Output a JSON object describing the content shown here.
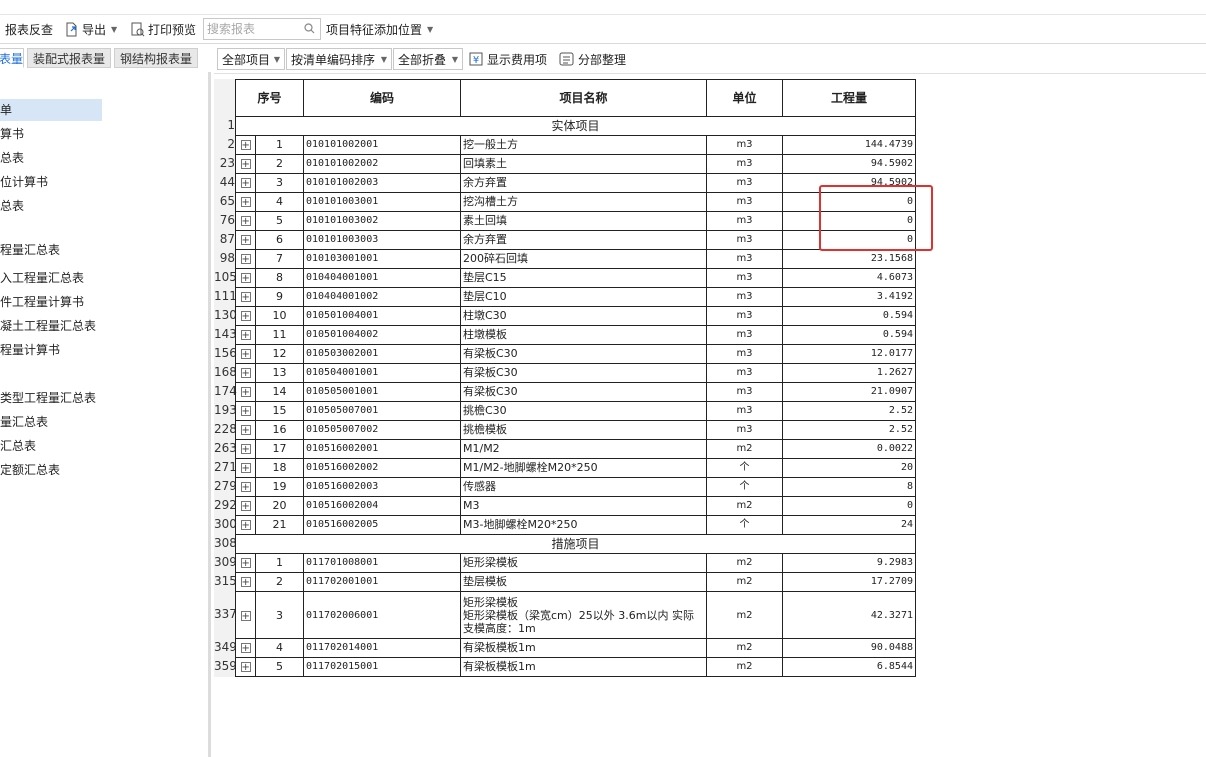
{
  "toolbar": {
    "check_label": "报表反查",
    "export_label": "导出",
    "print_label": "打印预览",
    "search_placeholder": "搜索报表",
    "feature_pos_label": "项目特征添加位置"
  },
  "tabs": [
    {
      "label": "表量",
      "active": true
    },
    {
      "label": "装配式报表量",
      "active": false
    },
    {
      "label": "钢结构报表量",
      "active": false
    }
  ],
  "sidebar": {
    "items": [
      {
        "label": "单",
        "selected": true
      },
      {
        "label": "算书"
      },
      {
        "label": "总表"
      },
      {
        "label": "位计算书"
      },
      {
        "label": "总表"
      },
      {
        "label": ""
      },
      {
        "label": "程量汇总表"
      },
      {
        "label": "入工程量汇总表"
      },
      {
        "label": "件工程量计算书"
      },
      {
        "label": "凝土工程量汇总表"
      },
      {
        "label": "程量计算书"
      },
      {
        "label": ""
      },
      {
        "label": "类型工程量汇总表"
      },
      {
        "label": "量汇总表"
      },
      {
        "label": "汇总表"
      },
      {
        "label": "定额汇总表"
      }
    ]
  },
  "toolbar2": {
    "all_items": "全部项目",
    "sort_by": "按清单编码排序",
    "fold_all": "全部折叠",
    "show_fee": "显示费用项",
    "arrange": "分部整理"
  },
  "table": {
    "headers": {
      "no": "序号",
      "code": "编码",
      "name": "项目名称",
      "unit": "单位",
      "qty": "工程量"
    },
    "rows": [
      {
        "type": "section",
        "rownum": "1",
        "title": "实体项目"
      },
      {
        "rownum": "2",
        "no": "1",
        "code": "010101002001",
        "name": "挖一般土方",
        "unit": "m3",
        "qty": "144.4739"
      },
      {
        "rownum": "23",
        "no": "2",
        "code": "010101002002",
        "name": "回填素土",
        "unit": "m3",
        "qty": "94.5902"
      },
      {
        "rownum": "44",
        "no": "3",
        "code": "010101002003",
        "name": "余方弃置",
        "unit": "m3",
        "qty": "94.5902"
      },
      {
        "rownum": "65",
        "no": "4",
        "code": "010101003001",
        "name": "挖沟槽土方",
        "unit": "m3",
        "qty": "0"
      },
      {
        "rownum": "76",
        "no": "5",
        "code": "010101003002",
        "name": "素土回填",
        "unit": "m3",
        "qty": "0"
      },
      {
        "rownum": "87",
        "no": "6",
        "code": "010101003003",
        "name": "余方弃置",
        "unit": "m3",
        "qty": "0"
      },
      {
        "rownum": "98",
        "no": "7",
        "code": "010103001001",
        "name": "200碎石回填",
        "unit": "m3",
        "qty": "23.1568"
      },
      {
        "rownum": "105",
        "no": "8",
        "code": "010404001001",
        "name": "垫层C15",
        "unit": "m3",
        "qty": "4.6073"
      },
      {
        "rownum": "111",
        "no": "9",
        "code": "010404001002",
        "name": "垫层C10",
        "unit": "m3",
        "qty": "3.4192"
      },
      {
        "rownum": "130",
        "no": "10",
        "code": "010501004001",
        "name": "柱墩C30",
        "unit": "m3",
        "qty": "0.594"
      },
      {
        "rownum": "143",
        "no": "11",
        "code": "010501004002",
        "name": "柱墩模板",
        "unit": "m3",
        "qty": "0.594"
      },
      {
        "rownum": "156",
        "no": "12",
        "code": "010503002001",
        "name": "有梁板C30",
        "unit": "m3",
        "qty": "12.0177"
      },
      {
        "rownum": "168",
        "no": "13",
        "code": "010504001001",
        "name": "有梁板C30",
        "unit": "m3",
        "qty": "1.2627"
      },
      {
        "rownum": "174",
        "no": "14",
        "code": "010505001001",
        "name": "有梁板C30",
        "unit": "m3",
        "qty": "21.0907"
      },
      {
        "rownum": "193",
        "no": "15",
        "code": "010505007001",
        "name": "挑檐C30",
        "unit": "m3",
        "qty": "2.52"
      },
      {
        "rownum": "228",
        "no": "16",
        "code": "010505007002",
        "name": "挑檐模板",
        "unit": "m3",
        "qty": "2.52"
      },
      {
        "rownum": "263",
        "no": "17",
        "code": "010516002001",
        "name": "M1/M2",
        "unit": "m2",
        "qty": "0.0022"
      },
      {
        "rownum": "271",
        "no": "18",
        "code": "010516002002",
        "name": "M1/M2-地脚螺栓M20*250",
        "unit": "个",
        "qty": "20"
      },
      {
        "rownum": "279",
        "no": "19",
        "code": "010516002003",
        "name": "传感器",
        "unit": "个",
        "qty": "8"
      },
      {
        "rownum": "292",
        "no": "20",
        "code": "010516002004",
        "name": "M3",
        "unit": "m2",
        "qty": "0"
      },
      {
        "rownum": "300",
        "no": "21",
        "code": "010516002005",
        "name": "M3-地脚螺栓M20*250",
        "unit": "个",
        "qty": "24"
      },
      {
        "type": "section",
        "rownum": "308",
        "title": "措施项目"
      },
      {
        "rownum": "309",
        "no": "1",
        "code": "011701008001",
        "name": "矩形梁模板",
        "unit": "m2",
        "qty": "9.2983"
      },
      {
        "rownum": "315",
        "no": "2",
        "code": "011702001001",
        "name": "垫层模板",
        "unit": "m2",
        "qty": "17.2709"
      },
      {
        "rownum": "337",
        "no": "3",
        "code": "011702006001",
        "name": "矩形梁模板\n矩形梁模板（梁宽cm）25以外 3.6m以内 实际支模高度：1m",
        "unit": "m2",
        "qty": "42.3271",
        "tall": true
      },
      {
        "rownum": "349",
        "no": "4",
        "code": "011702014001",
        "name": "有梁板模板1m",
        "unit": "m2",
        "qty": "90.0488"
      },
      {
        "rownum": "359",
        "no": "5",
        "code": "011702015001",
        "name": "有梁板模板1m",
        "unit": "m2",
        "qty": "6.8544"
      }
    ]
  },
  "colors": {
    "accent": "#1e6fd9",
    "highlight": "#e03030",
    "selected": "#d6e6f7"
  }
}
